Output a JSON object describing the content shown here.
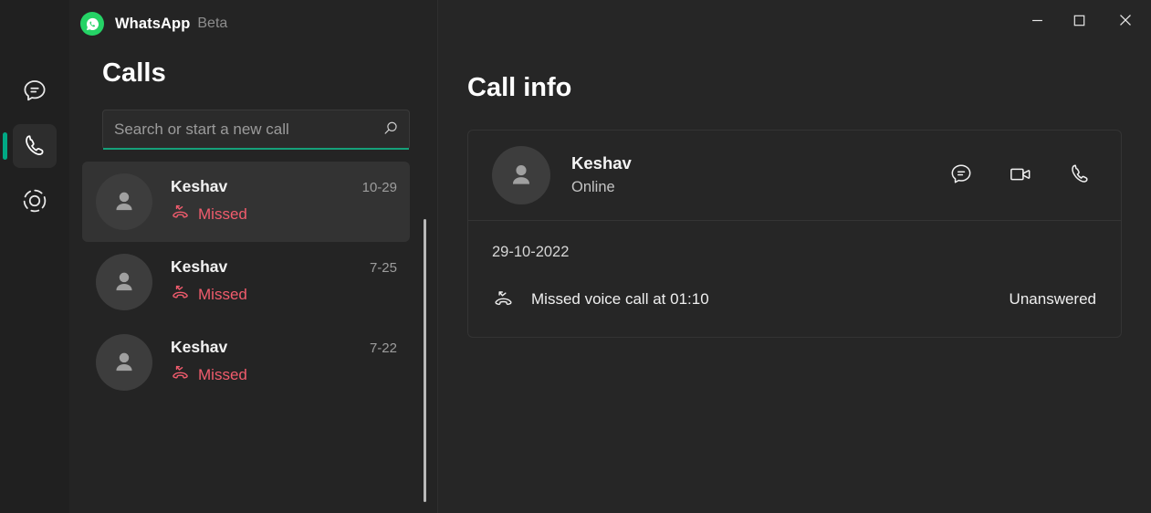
{
  "window": {
    "app_name": "WhatsApp",
    "app_tag": "Beta",
    "logo_icon": "whatsapp-logo-icon",
    "controls": [
      {
        "name": "minimize",
        "label": "Minimize",
        "icon": "minimize-icon"
      },
      {
        "name": "maximize",
        "label": "Maximize",
        "icon": "maximize-icon"
      },
      {
        "name": "close",
        "label": "Close",
        "icon": "close-icon"
      }
    ]
  },
  "rail": {
    "items": [
      {
        "name": "chats",
        "label": "Chats",
        "icon": "chat-bubble-icon",
        "active": false
      },
      {
        "name": "calls",
        "label": "Calls",
        "icon": "phone-icon",
        "active": true
      },
      {
        "name": "status",
        "label": "Status",
        "icon": "status-ring-icon",
        "active": false
      }
    ],
    "active_indicator_color": "#00a884"
  },
  "left_panel": {
    "title": "Calls",
    "search": {
      "placeholder": "Search or start a new call",
      "value": "",
      "icon": "search-icon",
      "underline_color": "#15a07a"
    },
    "calls": [
      {
        "name": "Keshav",
        "date": "10-29",
        "status": "Missed",
        "status_icon": "missed-call-icon",
        "selected": true
      },
      {
        "name": "Keshav",
        "date": "7-25",
        "status": "Missed",
        "status_icon": "missed-call-icon",
        "selected": false
      },
      {
        "name": "Keshav",
        "date": "7-22",
        "status": "Missed",
        "status_icon": "missed-call-icon",
        "selected": false
      }
    ],
    "status_color": "#f15c6d"
  },
  "right_panel": {
    "title": "Call info",
    "contact": {
      "name": "Keshav",
      "presence": "Online",
      "avatar_icon": "person-avatar-icon",
      "actions": [
        {
          "name": "message",
          "label": "Message",
          "icon": "chat-bubble-icon"
        },
        {
          "name": "video-call",
          "label": "Video call",
          "icon": "video-camera-icon"
        },
        {
          "name": "voice-call",
          "label": "Voice call",
          "icon": "phone-icon"
        }
      ]
    },
    "detail": {
      "date": "29-10-2022",
      "entry_icon": "missed-call-icon",
      "entry_label": "Missed voice call at 01:10",
      "entry_result": "Unanswered"
    }
  }
}
